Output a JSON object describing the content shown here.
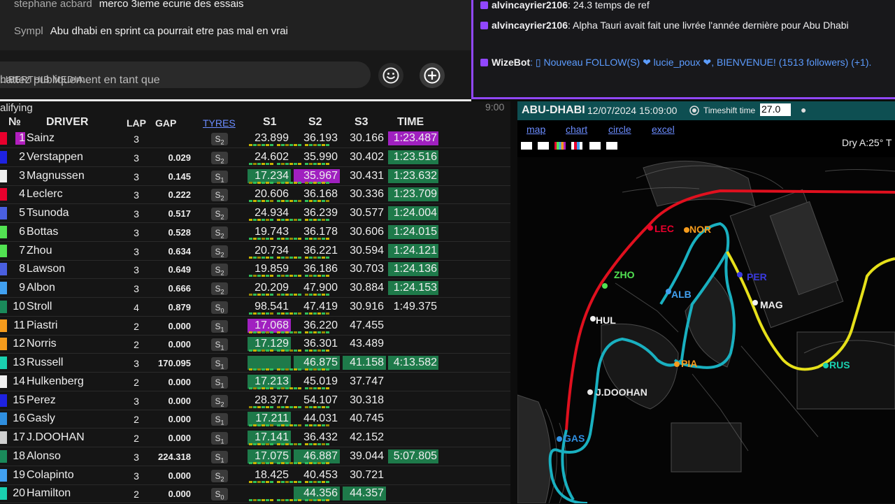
{
  "youtube": {
    "messages": [
      {
        "author": "stephane acbard",
        "text": "merco 3ieme ecurie des essais"
      },
      {
        "author": "Sympl",
        "text": "Abu dhabi en sprint ca pourrait etre pas mal en vrai"
      }
    ],
    "input_placeholder_prefix": "hattez publiquement en tant que ",
    "input_placeholder_channel": "LIBERTHIB MEDIA...",
    "emoji_icon": "smiley-icon",
    "plus_icon": "plus-circle-icon"
  },
  "twitch": {
    "lines": [
      {
        "user": "alvincayrier2106",
        "text": ": 24.3 temps de ref"
      },
      {
        "user": "alvincayrier2106",
        "text": ": Alpha Tauri avait fait une livrée l'année dernière pour Abu Dhabi"
      },
      {
        "user": "WizeBot",
        "text": ": ▯ Nouveau FOLLOW(S) ❤ lucie_poux ❤, BIENVENUE! (1513 followers) (+1)."
      }
    ]
  },
  "timing": {
    "session_label": "alifying",
    "headers": {
      "no": "№",
      "driver": "DRIVER",
      "lap": "LAP",
      "gap": "GAP",
      "tyres": "TYRES",
      "s1": "S1",
      "s2": "S2",
      "s3": "S3",
      "time": "TIME"
    },
    "rows": [
      {
        "pos": "1",
        "name": "Sainz",
        "lap": "3",
        "gap": "",
        "tyre": "S",
        "tyre_sub": "2",
        "s1": "23.899",
        "s2": "36.193",
        "s3": "30.166",
        "time": "1:23.487",
        "color": "#e8002d"
      },
      {
        "pos": "2",
        "name": "Verstappen",
        "lap": "3",
        "gap": "0.029",
        "tyre": "S",
        "tyre_sub": "2",
        "s1": "24.602",
        "s2": "35.990",
        "s3": "30.402",
        "time": "1:23.516",
        "color": "#1e22e0"
      },
      {
        "pos": "3",
        "name": "Magnussen",
        "lap": "3",
        "gap": "0.145",
        "tyre": "S",
        "tyre_sub": "1",
        "s1": "17.234",
        "s2": "35.967",
        "s3": "30.431",
        "time": "1:23.632",
        "color": "#f0f0f0"
      },
      {
        "pos": "4",
        "name": "Leclerc",
        "lap": "3",
        "gap": "0.222",
        "tyre": "S",
        "tyre_sub": "2",
        "s1": "20.606",
        "s2": "36.168",
        "s3": "30.336",
        "time": "1:23.709",
        "color": "#e8002d"
      },
      {
        "pos": "5",
        "name": "Tsunoda",
        "lap": "3",
        "gap": "0.517",
        "tyre": "S",
        "tyre_sub": "2",
        "s1": "24.934",
        "s2": "36.239",
        "s3": "30.577",
        "time": "1:24.004",
        "color": "#4a5fe0"
      },
      {
        "pos": "6",
        "name": "Bottas",
        "lap": "3",
        "gap": "0.528",
        "tyre": "S",
        "tyre_sub": "2",
        "s1": "19.743",
        "s2": "36.178",
        "s3": "30.606",
        "time": "1:24.015",
        "color": "#52e252"
      },
      {
        "pos": "7",
        "name": "Zhou",
        "lap": "3",
        "gap": "0.634",
        "tyre": "S",
        "tyre_sub": "2",
        "s1": "20.734",
        "s2": "36.221",
        "s3": "30.594",
        "time": "1:24.121",
        "color": "#52e252"
      },
      {
        "pos": "8",
        "name": "Lawson",
        "lap": "3",
        "gap": "0.649",
        "tyre": "S",
        "tyre_sub": "2",
        "s1": "19.859",
        "s2": "36.186",
        "s3": "30.703",
        "time": "1:24.136",
        "color": "#4a5fe0"
      },
      {
        "pos": "9",
        "name": "Albon",
        "lap": "3",
        "gap": "0.666",
        "tyre": "S",
        "tyre_sub": "2",
        "s1": "20.209",
        "s2": "47.900",
        "s3": "30.884",
        "time": "1:24.153",
        "color": "#41a0f0"
      },
      {
        "pos": "10",
        "name": "Stroll",
        "lap": "4",
        "gap": "0.879",
        "tyre": "S",
        "tyre_sub": "0",
        "s1": "98.541",
        "s2": "47.419",
        "s3": "30.916",
        "time": "1:49.375",
        "color": "#1a8a5a"
      },
      {
        "pos": "11",
        "name": "Piastri",
        "lap": "2",
        "gap": "0.000",
        "tyre": "S",
        "tyre_sub": "1",
        "s1": "17.068",
        "s2": "36.220",
        "s3": "47.455",
        "time": "",
        "color": "#f59b1c"
      },
      {
        "pos": "12",
        "name": "Norris",
        "lap": "2",
        "gap": "0.000",
        "tyre": "S",
        "tyre_sub": "1",
        "s1": "17.129",
        "s2": "36.301",
        "s3": "43.489",
        "time": "",
        "color": "#f59b1c"
      },
      {
        "pos": "13",
        "name": "Russell",
        "lap": "3",
        "gap": "170.095",
        "tyre": "S",
        "tyre_sub": "1",
        "s1": "",
        "s2": "46.875",
        "s3": "41.158",
        "time": "4:13.582",
        "color": "#1ad0b0"
      },
      {
        "pos": "14",
        "name": "Hulkenberg",
        "lap": "2",
        "gap": "0.000",
        "tyre": "S",
        "tyre_sub": "1",
        "s1": "17.213",
        "s2": "45.019",
        "s3": "37.747",
        "time": "",
        "color": "#f0f0f0"
      },
      {
        "pos": "15",
        "name": "Perez",
        "lap": "3",
        "gap": "0.000",
        "tyre": "S",
        "tyre_sub": "2",
        "s1": "28.377",
        "s2": "54.107",
        "s3": "30.318",
        "time": "",
        "color": "#1e22e0"
      },
      {
        "pos": "16",
        "name": "Gasly",
        "lap": "2",
        "gap": "0.000",
        "tyre": "S",
        "tyre_sub": "1",
        "s1": "17.211",
        "s2": "44.031",
        "s3": "40.745",
        "time": "",
        "color": "#2f8fe0"
      },
      {
        "pos": "17",
        "name": "J.DOOHAN",
        "lap": "2",
        "gap": "0.000",
        "tyre": "S",
        "tyre_sub": "1",
        "s1": "17.141",
        "s2": "36.432",
        "s3": "42.152",
        "time": "",
        "color": "#d0d0d0"
      },
      {
        "pos": "18",
        "name": "Alonso",
        "lap": "3",
        "gap": "224.318",
        "tyre": "S",
        "tyre_sub": "1",
        "s1": "17.075",
        "s2": "46.887",
        "s3": "39.044",
        "time": "5:07.805",
        "color": "#1a8a5a"
      },
      {
        "pos": "19",
        "name": "Colapinto",
        "lap": "3",
        "gap": "0.000",
        "tyre": "S",
        "tyre_sub": "2",
        "s1": "18.425",
        "s2": "40.453",
        "s3": "30.721",
        "time": "",
        "color": "#41a0f0"
      },
      {
        "pos": "20",
        "name": "Hamilton",
        "lap": "2",
        "gap": "0.000",
        "tyre": "S",
        "tyre_sub": "0",
        "s1": "",
        "s2": "44.356",
        "s3": "44.357",
        "time": "",
        "color": "#1ad0b0"
      }
    ]
  },
  "map": {
    "clock": "9:00",
    "track": "ABU-DHABI",
    "datetime": "12/07/2024 15:09:00",
    "timeshift_label": "Timeshift time",
    "timeshift_value": "27.0",
    "links": [
      "map",
      "chart",
      "circle",
      "excel"
    ],
    "weather": "Dry A:25° T",
    "cars": [
      {
        "code": "LEC",
        "color": "#e8002d"
      },
      {
        "code": "NOR",
        "color": "#f59b1c"
      },
      {
        "code": "ZHO",
        "color": "#52e252"
      },
      {
        "code": "PER",
        "color": "#3a3ae0"
      },
      {
        "code": "ALB",
        "color": "#41a0f0"
      },
      {
        "code": "MAG",
        "color": "#f0f0f0"
      },
      {
        "code": "HUL",
        "color": "#f0f0f0"
      },
      {
        "code": "PIA",
        "color": "#f59b1c"
      },
      {
        "code": "RUS",
        "color": "#1ad0b0"
      },
      {
        "code": "J.DOOHAN",
        "color": "#e8e8e8"
      },
      {
        "code": "GAS",
        "color": "#2f8fe0"
      }
    ]
  }
}
